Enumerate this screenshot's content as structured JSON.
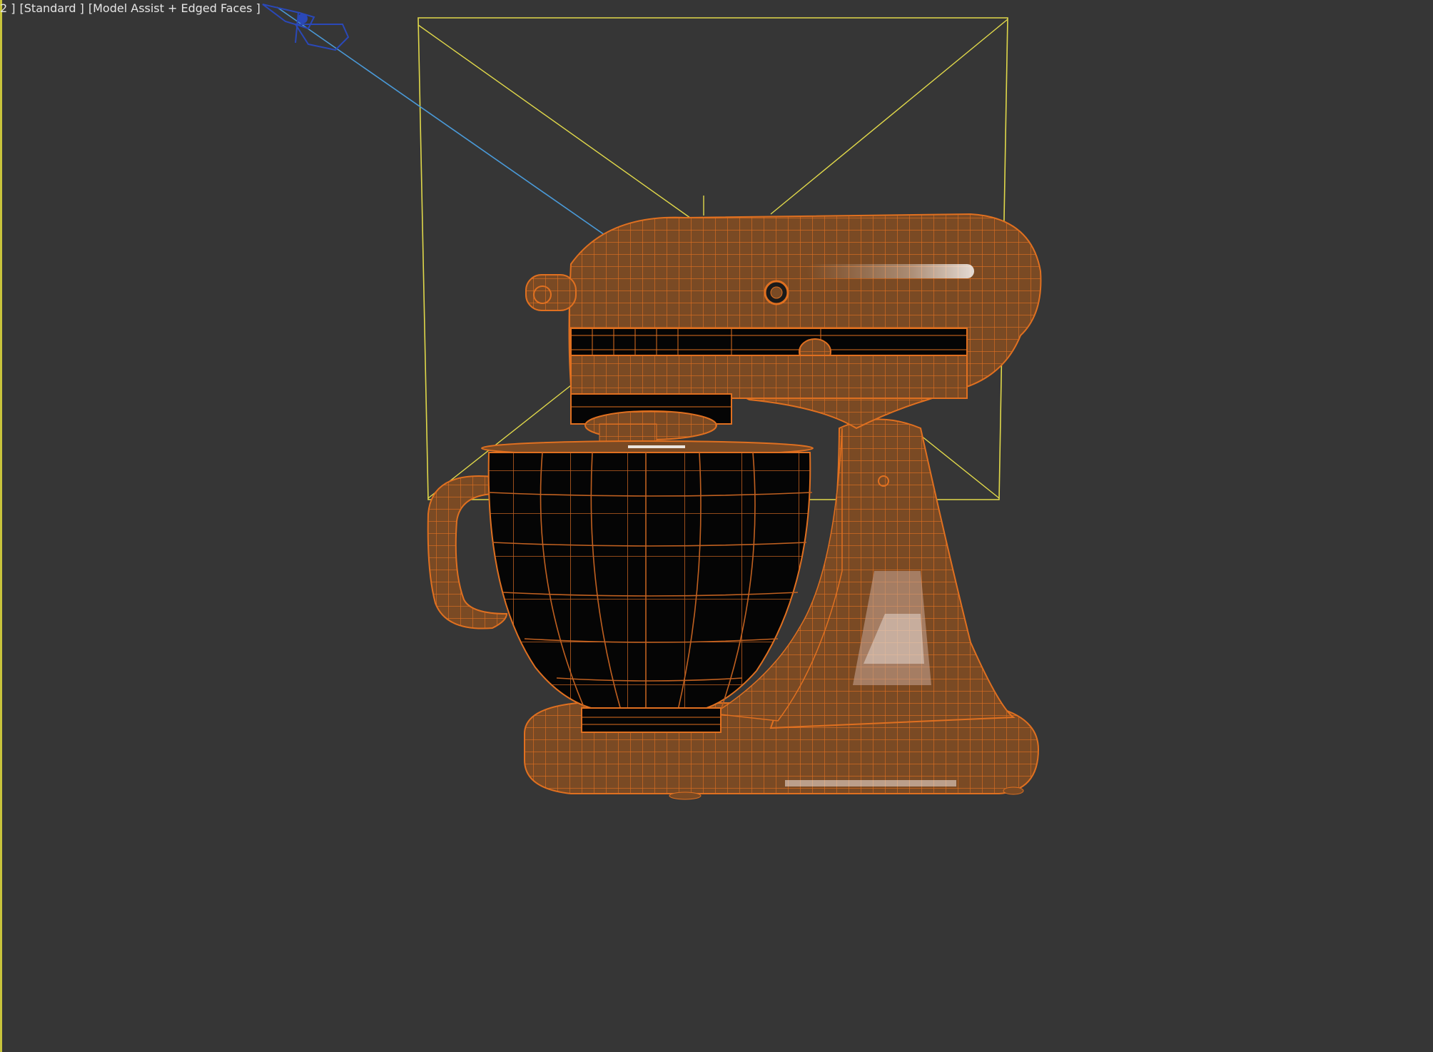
{
  "viewport": {
    "label_prefix": "2 ]",
    "shading_mode": "[Standard ]",
    "display_mode": "[Model Assist + Edged Faces ]",
    "background_color": "#363636"
  },
  "scene": {
    "object": "stand-mixer",
    "object_color": "#7a4a24",
    "wire_color": "#e07020",
    "bowl_color": "#050505",
    "light_color": "#e0d84a",
    "target_line_color": "#4a9ad8",
    "camera_icon": "spotlight-icon"
  }
}
